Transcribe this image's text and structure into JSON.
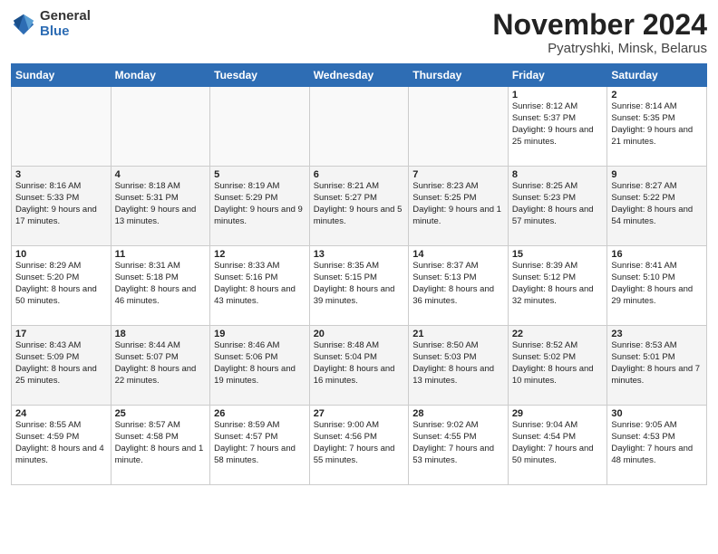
{
  "header": {
    "logo_line1": "General",
    "logo_line2": "Blue",
    "month": "November 2024",
    "location": "Pyatryshki, Minsk, Belarus"
  },
  "weekdays": [
    "Sunday",
    "Monday",
    "Tuesday",
    "Wednesday",
    "Thursday",
    "Friday",
    "Saturday"
  ],
  "weeks": [
    [
      {
        "day": "",
        "text": ""
      },
      {
        "day": "",
        "text": ""
      },
      {
        "day": "",
        "text": ""
      },
      {
        "day": "",
        "text": ""
      },
      {
        "day": "",
        "text": ""
      },
      {
        "day": "1",
        "text": "Sunrise: 8:12 AM\nSunset: 5:37 PM\nDaylight: 9 hours and 25 minutes."
      },
      {
        "day": "2",
        "text": "Sunrise: 8:14 AM\nSunset: 5:35 PM\nDaylight: 9 hours and 21 minutes."
      }
    ],
    [
      {
        "day": "3",
        "text": "Sunrise: 8:16 AM\nSunset: 5:33 PM\nDaylight: 9 hours and 17 minutes."
      },
      {
        "day": "4",
        "text": "Sunrise: 8:18 AM\nSunset: 5:31 PM\nDaylight: 9 hours and 13 minutes."
      },
      {
        "day": "5",
        "text": "Sunrise: 8:19 AM\nSunset: 5:29 PM\nDaylight: 9 hours and 9 minutes."
      },
      {
        "day": "6",
        "text": "Sunrise: 8:21 AM\nSunset: 5:27 PM\nDaylight: 9 hours and 5 minutes."
      },
      {
        "day": "7",
        "text": "Sunrise: 8:23 AM\nSunset: 5:25 PM\nDaylight: 9 hours and 1 minute."
      },
      {
        "day": "8",
        "text": "Sunrise: 8:25 AM\nSunset: 5:23 PM\nDaylight: 8 hours and 57 minutes."
      },
      {
        "day": "9",
        "text": "Sunrise: 8:27 AM\nSunset: 5:22 PM\nDaylight: 8 hours and 54 minutes."
      }
    ],
    [
      {
        "day": "10",
        "text": "Sunrise: 8:29 AM\nSunset: 5:20 PM\nDaylight: 8 hours and 50 minutes."
      },
      {
        "day": "11",
        "text": "Sunrise: 8:31 AM\nSunset: 5:18 PM\nDaylight: 8 hours and 46 minutes."
      },
      {
        "day": "12",
        "text": "Sunrise: 8:33 AM\nSunset: 5:16 PM\nDaylight: 8 hours and 43 minutes."
      },
      {
        "day": "13",
        "text": "Sunrise: 8:35 AM\nSunset: 5:15 PM\nDaylight: 8 hours and 39 minutes."
      },
      {
        "day": "14",
        "text": "Sunrise: 8:37 AM\nSunset: 5:13 PM\nDaylight: 8 hours and 36 minutes."
      },
      {
        "day": "15",
        "text": "Sunrise: 8:39 AM\nSunset: 5:12 PM\nDaylight: 8 hours and 32 minutes."
      },
      {
        "day": "16",
        "text": "Sunrise: 8:41 AM\nSunset: 5:10 PM\nDaylight: 8 hours and 29 minutes."
      }
    ],
    [
      {
        "day": "17",
        "text": "Sunrise: 8:43 AM\nSunset: 5:09 PM\nDaylight: 8 hours and 25 minutes."
      },
      {
        "day": "18",
        "text": "Sunrise: 8:44 AM\nSunset: 5:07 PM\nDaylight: 8 hours and 22 minutes."
      },
      {
        "day": "19",
        "text": "Sunrise: 8:46 AM\nSunset: 5:06 PM\nDaylight: 8 hours and 19 minutes."
      },
      {
        "day": "20",
        "text": "Sunrise: 8:48 AM\nSunset: 5:04 PM\nDaylight: 8 hours and 16 minutes."
      },
      {
        "day": "21",
        "text": "Sunrise: 8:50 AM\nSunset: 5:03 PM\nDaylight: 8 hours and 13 minutes."
      },
      {
        "day": "22",
        "text": "Sunrise: 8:52 AM\nSunset: 5:02 PM\nDaylight: 8 hours and 10 minutes."
      },
      {
        "day": "23",
        "text": "Sunrise: 8:53 AM\nSunset: 5:01 PM\nDaylight: 8 hours and 7 minutes."
      }
    ],
    [
      {
        "day": "24",
        "text": "Sunrise: 8:55 AM\nSunset: 4:59 PM\nDaylight: 8 hours and 4 minutes."
      },
      {
        "day": "25",
        "text": "Sunrise: 8:57 AM\nSunset: 4:58 PM\nDaylight: 8 hours and 1 minute."
      },
      {
        "day": "26",
        "text": "Sunrise: 8:59 AM\nSunset: 4:57 PM\nDaylight: 7 hours and 58 minutes."
      },
      {
        "day": "27",
        "text": "Sunrise: 9:00 AM\nSunset: 4:56 PM\nDaylight: 7 hours and 55 minutes."
      },
      {
        "day": "28",
        "text": "Sunrise: 9:02 AM\nSunset: 4:55 PM\nDaylight: 7 hours and 53 minutes."
      },
      {
        "day": "29",
        "text": "Sunrise: 9:04 AM\nSunset: 4:54 PM\nDaylight: 7 hours and 50 minutes."
      },
      {
        "day": "30",
        "text": "Sunrise: 9:05 AM\nSunset: 4:53 PM\nDaylight: 7 hours and 48 minutes."
      }
    ]
  ]
}
